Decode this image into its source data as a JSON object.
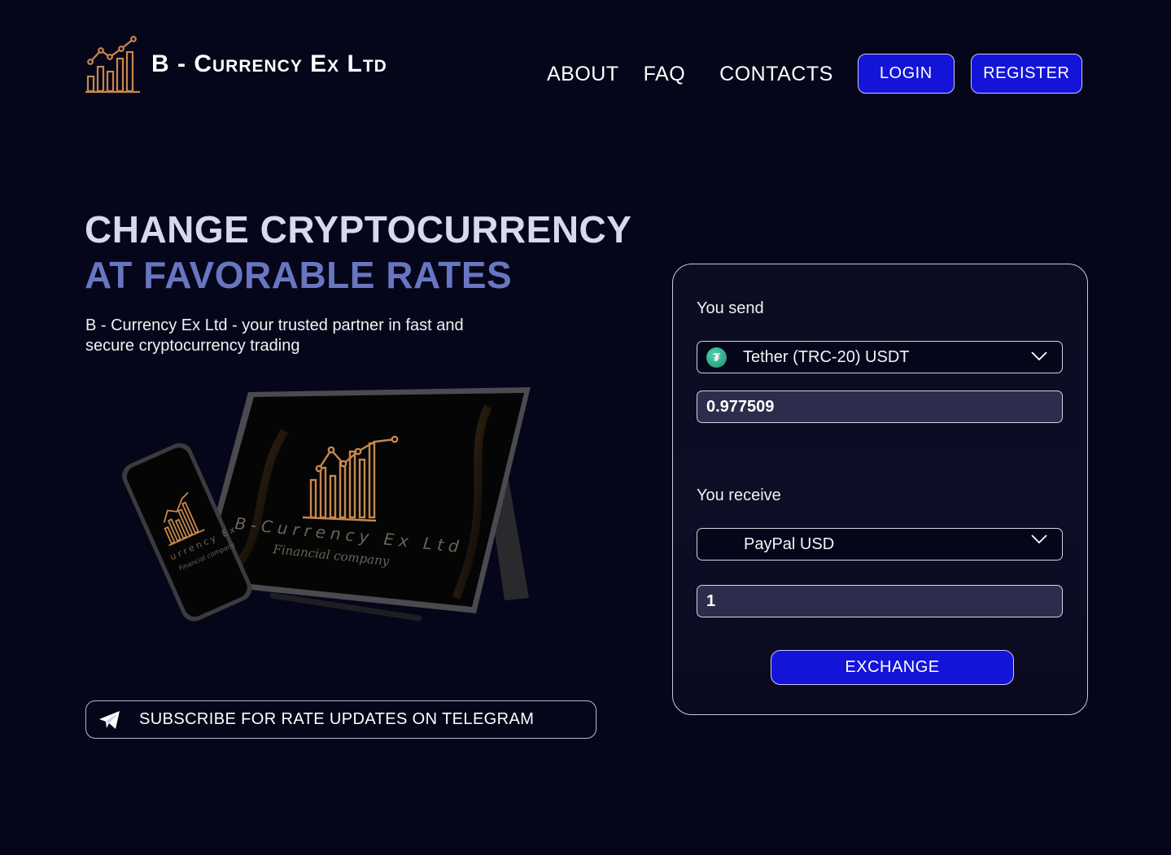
{
  "header": {
    "brand": "B - Currency Ex Ltd",
    "nav": {
      "about": "ABOUT",
      "faq": "FAQ",
      "contacts": "CONTACTS"
    },
    "login_label": "LOGIN",
    "register_label": "REGISTER"
  },
  "hero": {
    "title_line1": "CHANGE CRYPTOCURRENCY",
    "title_line2": "AT FAVORABLE RATES",
    "description": "B - Currency Ex Ltd - your trusted partner in fast and secure cryptocurrency trading",
    "illustration": {
      "tablet_brand": "B-Currency Ex Ltd",
      "tablet_tagline": "Financial company",
      "phone_brand": "urrency Ex",
      "phone_tagline": "Financial company"
    }
  },
  "telegram": {
    "label": "SUBSCRIBE FOR RATE UPDATES ON TELEGRAM",
    "icon": "telegram-plane-icon"
  },
  "exchange": {
    "send_label": "You send",
    "send_currency": "Tether (TRC-20) USDT",
    "send_currency_icon": "tether-icon",
    "send_amount": "0.977509",
    "receive_label": "You receive",
    "receive_currency": "PayPal USD",
    "receive_amount": "1",
    "button_label": "EXCHANGE"
  },
  "colors": {
    "background": "#06061a",
    "accent": "#1414d8",
    "logo_gold": "#c8874c",
    "title_light": "#d6d9ef",
    "title_blue": "#6876c2",
    "input_fill": "#2e2c4c"
  }
}
